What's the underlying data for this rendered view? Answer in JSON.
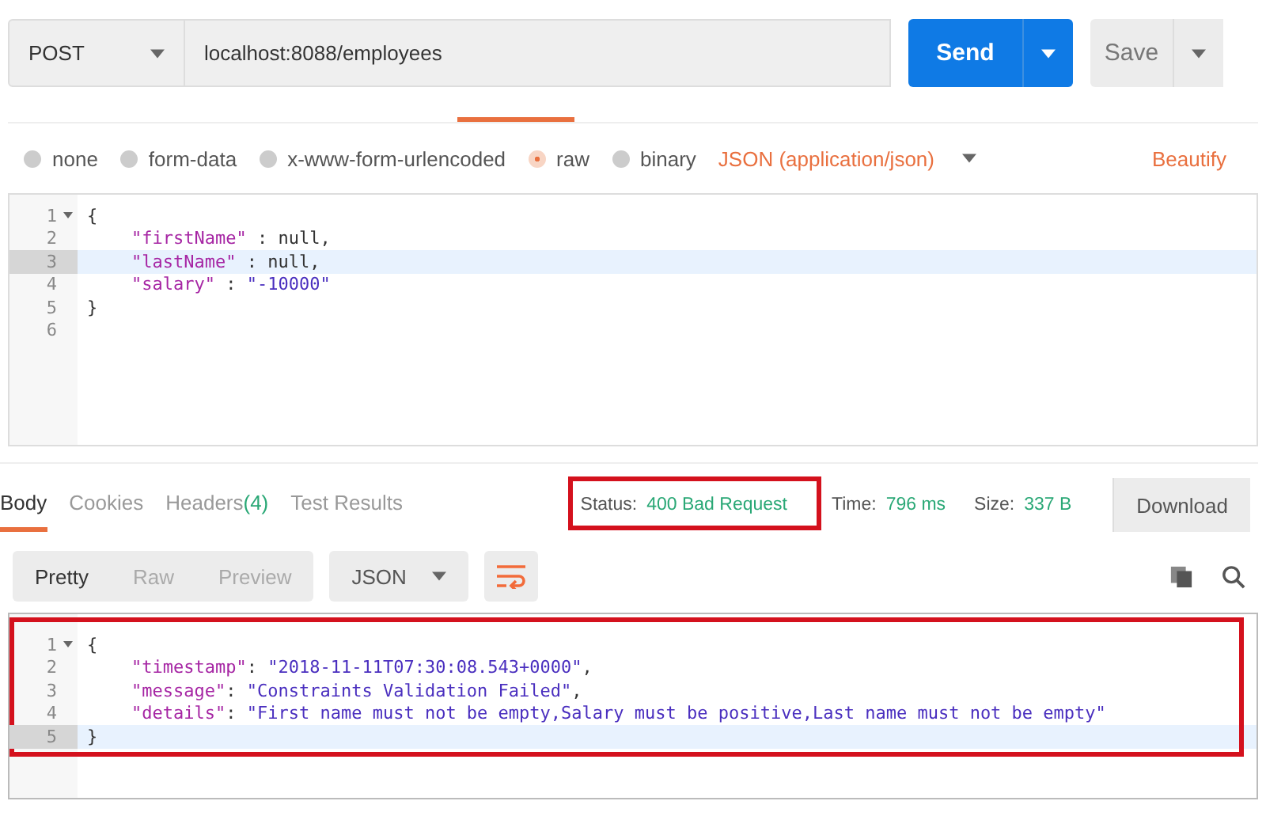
{
  "request": {
    "method": "POST",
    "url": "localhost:8088/employees",
    "send": "Send",
    "save": "Save"
  },
  "body_types": [
    {
      "label": "none",
      "selected": false
    },
    {
      "label": "form-data",
      "selected": false
    },
    {
      "label": "x-www-form-urlencoded",
      "selected": false
    },
    {
      "label": "raw",
      "selected": true
    },
    {
      "label": "binary",
      "selected": false
    }
  ],
  "format": "JSON (application/json)",
  "beautify": "Beautify",
  "request_body": [
    {
      "number": "1",
      "kind": "brace",
      "current": false,
      "foldable": true,
      "tokens": [
        {
          "text": "{",
          "kind": "punct"
        }
      ]
    },
    {
      "number": "2",
      "kind": "member",
      "current": false,
      "foldable": false,
      "tokens": [
        {
          "text": "\"firstName\"",
          "kind": "key"
        },
        {
          "text": " : ",
          "kind": "punct"
        },
        {
          "text": "null",
          "kind": "null"
        },
        {
          "text": ",",
          "kind": "punct"
        }
      ]
    },
    {
      "number": "3",
      "kind": "member",
      "current": true,
      "foldable": false,
      "tokens": [
        {
          "text": "\"lastName\"",
          "kind": "key"
        },
        {
          "text": " : ",
          "kind": "punct"
        },
        {
          "text": "null",
          "kind": "null"
        },
        {
          "text": ",",
          "kind": "punct"
        }
      ]
    },
    {
      "number": "4",
      "kind": "member",
      "current": false,
      "foldable": false,
      "tokens": [
        {
          "text": "\"salary\"",
          "kind": "key"
        },
        {
          "text": " : ",
          "kind": "punct"
        },
        {
          "text": "\"-10000\"",
          "kind": "value"
        }
      ]
    },
    {
      "number": "5",
      "kind": "brace",
      "current": false,
      "foldable": false,
      "tokens": [
        {
          "text": "}",
          "kind": "punct"
        }
      ]
    },
    {
      "number": "6",
      "current": false,
      "foldable": false
    }
  ],
  "response": {
    "tabs": [
      {
        "label": "Body",
        "selected": true
      },
      {
        "label": "Cookies",
        "selected": false
      },
      {
        "label": "Headers",
        "count": "(4)",
        "selected": false
      },
      {
        "label": "Test Results",
        "selected": false
      }
    ],
    "status_label": "Status:",
    "status": "400 Bad Request",
    "time_label": "Time:",
    "time": "796 ms",
    "size_label": "Size:",
    "size": "337 B",
    "download": "Download",
    "view_tabs": [
      {
        "label": "Pretty",
        "selected": true
      },
      {
        "label": "Raw",
        "selected": false
      },
      {
        "label": "Preview",
        "selected": false
      }
    ],
    "language": "JSON",
    "body": [
      {
        "number": "1",
        "kind": "brace",
        "current": false,
        "foldable": true,
        "tokens": [
          {
            "text": "{",
            "kind": "punct"
          }
        ]
      },
      {
        "number": "2",
        "kind": "member",
        "current": false,
        "foldable": false,
        "tokens": [
          {
            "text": "\"timestamp\"",
            "kind": "key"
          },
          {
            "text": ": ",
            "kind": "punct"
          },
          {
            "text": "\"2018-11-11T07:30:08.543+0000\"",
            "kind": "value"
          },
          {
            "text": ",",
            "kind": "punct"
          }
        ]
      },
      {
        "number": "3",
        "kind": "member",
        "current": false,
        "foldable": false,
        "tokens": [
          {
            "text": "\"message\"",
            "kind": "key"
          },
          {
            "text": ": ",
            "kind": "punct"
          },
          {
            "text": "\"Constraints Validation Failed\"",
            "kind": "value"
          },
          {
            "text": ",",
            "kind": "punct"
          }
        ]
      },
      {
        "number": "4",
        "kind": "member",
        "current": false,
        "foldable": false,
        "tokens": [
          {
            "text": "\"details\"",
            "kind": "key"
          },
          {
            "text": ": ",
            "kind": "punct"
          },
          {
            "text": "\"First name must not be empty,Salary must be positive,Last name must not be empty\"",
            "kind": "value"
          }
        ]
      },
      {
        "number": "5",
        "kind": "brace",
        "current": true,
        "foldable": false,
        "tokens": [
          {
            "text": "}",
            "kind": "punct"
          }
        ]
      }
    ]
  }
}
